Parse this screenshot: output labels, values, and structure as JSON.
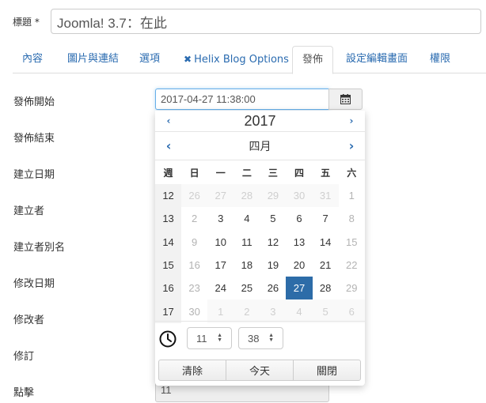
{
  "title_field": {
    "label": "標題 *",
    "value": "Joomla! 3.7：在此"
  },
  "tabs": [
    {
      "label": "內容",
      "active": false
    },
    {
      "label": "圖片與連結",
      "active": false
    },
    {
      "label": "選項",
      "active": false
    },
    {
      "label": "Helix Blog Options",
      "icon": "joomla-icon",
      "active": false
    },
    {
      "label": "發佈",
      "active": true
    },
    {
      "label": "設定編輯畫面",
      "active": false
    },
    {
      "label": "權限",
      "active": false
    }
  ],
  "fields": {
    "publish_up": {
      "label": "發佈開始",
      "value": "2017-04-27 11:38:00"
    },
    "publish_down": {
      "label": "發佈結束"
    },
    "created": {
      "label": "建立日期"
    },
    "created_by": {
      "label": "建立者"
    },
    "created_by_alias": {
      "label": "建立者別名"
    },
    "modified": {
      "label": "修改日期"
    },
    "modified_by": {
      "label": "修改者"
    },
    "version": {
      "label": "修訂"
    },
    "hits": {
      "label": "點擊",
      "value": "11"
    }
  },
  "calendar": {
    "year": "2017",
    "month": "四月",
    "prev_symbol": "‹",
    "next_symbol": "›",
    "headers": [
      "週",
      "日",
      "一",
      "二",
      "三",
      "四",
      "五",
      "六"
    ],
    "weeks": [
      {
        "week": "12",
        "days": [
          {
            "d": "26",
            "s": "outside"
          },
          {
            "d": "27",
            "s": "outside"
          },
          {
            "d": "28",
            "s": "outside"
          },
          {
            "d": "29",
            "s": "outside"
          },
          {
            "d": "30",
            "s": "outside"
          },
          {
            "d": "31",
            "s": "outside"
          },
          {
            "d": "1",
            "s": "muted"
          }
        ]
      },
      {
        "week": "13",
        "days": [
          {
            "d": "2",
            "s": "muted"
          },
          {
            "d": "3",
            "s": ""
          },
          {
            "d": "4",
            "s": ""
          },
          {
            "d": "5",
            "s": ""
          },
          {
            "d": "6",
            "s": ""
          },
          {
            "d": "7",
            "s": ""
          },
          {
            "d": "8",
            "s": "muted"
          }
        ]
      },
      {
        "week": "14",
        "days": [
          {
            "d": "9",
            "s": "muted"
          },
          {
            "d": "10",
            "s": ""
          },
          {
            "d": "11",
            "s": ""
          },
          {
            "d": "12",
            "s": ""
          },
          {
            "d": "13",
            "s": ""
          },
          {
            "d": "14",
            "s": ""
          },
          {
            "d": "15",
            "s": "muted"
          }
        ]
      },
      {
        "week": "15",
        "days": [
          {
            "d": "16",
            "s": "muted"
          },
          {
            "d": "17",
            "s": ""
          },
          {
            "d": "18",
            "s": ""
          },
          {
            "d": "19",
            "s": ""
          },
          {
            "d": "20",
            "s": ""
          },
          {
            "d": "21",
            "s": ""
          },
          {
            "d": "22",
            "s": "muted"
          }
        ]
      },
      {
        "week": "16",
        "days": [
          {
            "d": "23",
            "s": "muted"
          },
          {
            "d": "24",
            "s": ""
          },
          {
            "d": "25",
            "s": ""
          },
          {
            "d": "26",
            "s": ""
          },
          {
            "d": "27",
            "s": "selected"
          },
          {
            "d": "28",
            "s": ""
          },
          {
            "d": "29",
            "s": "muted"
          }
        ]
      },
      {
        "week": "17",
        "days": [
          {
            "d": "30",
            "s": "muted"
          },
          {
            "d": "1",
            "s": "outside"
          },
          {
            "d": "2",
            "s": "outside"
          },
          {
            "d": "3",
            "s": "outside"
          },
          {
            "d": "4",
            "s": "outside"
          },
          {
            "d": "5",
            "s": "outside"
          },
          {
            "d": "6",
            "s": "outside"
          }
        ]
      }
    ],
    "hour": "11",
    "minute": "38",
    "buttons": {
      "clear": "清除",
      "today": "今天",
      "close": "關閉"
    }
  },
  "colors": {
    "link": "#2a6bb0",
    "selected_day": "#2d6ca8"
  }
}
